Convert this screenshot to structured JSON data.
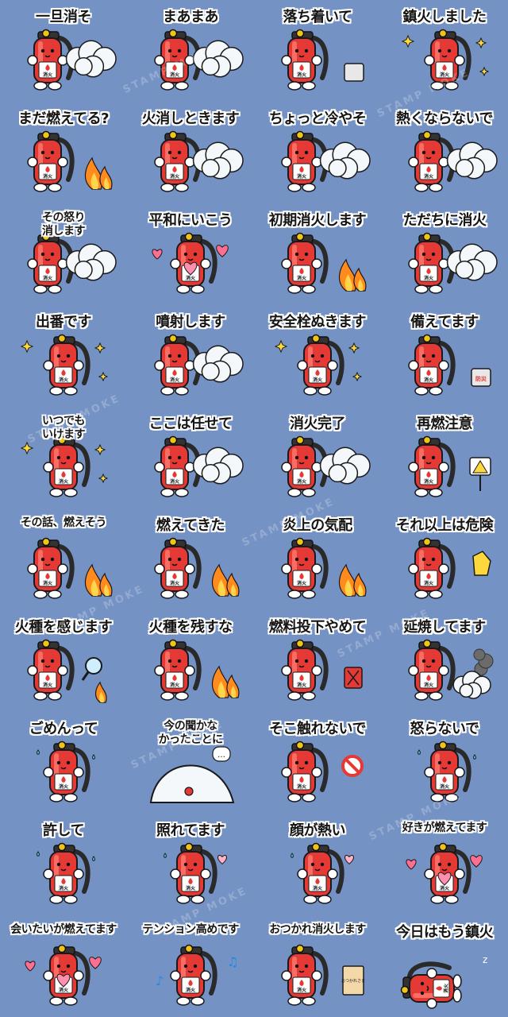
{
  "watermark": "STAMP MOKE",
  "extinguisher_label": "消火",
  "stickers": [
    {
      "caption": "一旦消そ",
      "effect": "spray"
    },
    {
      "caption": "まあまあ",
      "effect": "spray"
    },
    {
      "caption": "落ち着いて",
      "effect": "box"
    },
    {
      "caption": "鎮火しました",
      "effect": "sparkle"
    },
    {
      "caption": "まだ燃えてる?",
      "effect": "fire"
    },
    {
      "caption": "火消しときます",
      "effect": "spray"
    },
    {
      "caption": "ちょっと冷やそ",
      "effect": "spray"
    },
    {
      "caption": "熱くならないで",
      "effect": "spray"
    },
    {
      "caption": "その怒り\n消します",
      "effect": "spray"
    },
    {
      "caption": "平和にいこう",
      "effect": "heart"
    },
    {
      "caption": "初期消火します",
      "effect": "fire"
    },
    {
      "caption": "ただちに消火",
      "effect": "spray"
    },
    {
      "caption": "出番です",
      "effect": "sparkle"
    },
    {
      "caption": "噴射します",
      "effect": "spray"
    },
    {
      "caption": "安全栓ぬきます",
      "effect": "sparkle"
    },
    {
      "caption": "備えてます",
      "effect": "box",
      "box_text": "防災"
    },
    {
      "caption": "いつでも\nいけます",
      "effect": "sparkle"
    },
    {
      "caption": "ここは任せて",
      "effect": "spray"
    },
    {
      "caption": "消火完了",
      "effect": "spray"
    },
    {
      "caption": "再燃注意",
      "effect": "warning"
    },
    {
      "caption": "その話、燃えそう",
      "effect": "fire"
    },
    {
      "caption": "燃えてきた",
      "effect": "fire"
    },
    {
      "caption": "炎上の気配",
      "effect": "fire"
    },
    {
      "caption": "それ以上は危険",
      "effect": "stop"
    },
    {
      "caption": "火種を感じます",
      "effect": "magnifier"
    },
    {
      "caption": "火種を残すな",
      "effect": "fire"
    },
    {
      "caption": "燃料投下やめて",
      "effect": "can"
    },
    {
      "caption": "延焼してます",
      "effect": "smoke"
    },
    {
      "caption": "ごめんって",
      "effect": "sweat"
    },
    {
      "caption": "今の聞かな\nかったことに",
      "effect": "blanket",
      "bubble": "…"
    },
    {
      "caption": "そこ触れないで",
      "effect": "prohibit"
    },
    {
      "caption": "怒らないで",
      "effect": "sweat"
    },
    {
      "caption": "許して",
      "effect": "sweat"
    },
    {
      "caption": "照れてます",
      "effect": "blush"
    },
    {
      "caption": "顔が熱い",
      "effect": "blush"
    },
    {
      "caption": "好きが燃えてます",
      "effect": "heart"
    },
    {
      "caption": "会いたいが燃えてます",
      "effect": "heart"
    },
    {
      "caption": "テンション高めです",
      "effect": "music"
    },
    {
      "caption": "おつかれ消火します",
      "effect": "sign",
      "sign_text": "おつかれさま"
    },
    {
      "caption": "今日はもう鎮火",
      "effect": "sleep"
    }
  ]
}
